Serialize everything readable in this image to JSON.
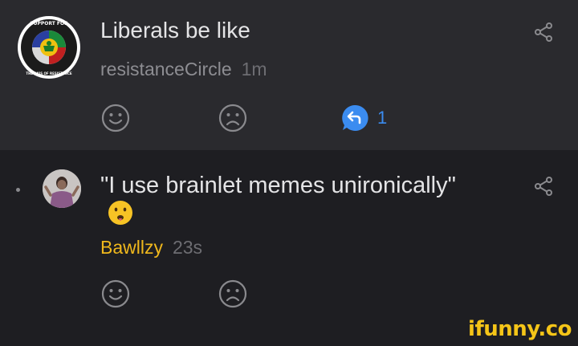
{
  "post": {
    "title": "Liberals be like",
    "author": "resistanceCircle",
    "time": "1m",
    "reply_count": "1",
    "badge_text_top": "SUPPORT FOR",
    "badge_text_bottom": "THE AXIS OF RESISTANCE"
  },
  "reply": {
    "text": "\"I use brainlet memes unironically\"",
    "author": "Bawllzy",
    "time": "23s"
  },
  "watermark": "ifunny.co",
  "colors": {
    "post_bg": "#2a2a2e",
    "reply_bg": "#1e1e22",
    "reply_accent": "#3b8cf0",
    "author_gold": "#f0b81c"
  }
}
